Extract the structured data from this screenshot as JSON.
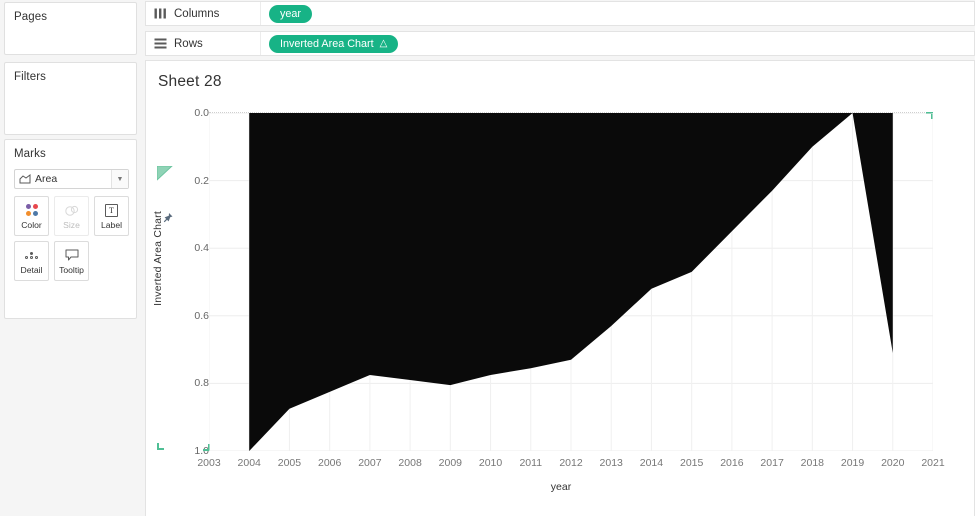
{
  "left_panel": {
    "pages": {
      "title": "Pages"
    },
    "filters": {
      "title": "Filters"
    },
    "marks": {
      "title": "Marks",
      "type_label": "Area",
      "type_icon": "area-chart-icon",
      "caret_icon": "chevron-down-icon",
      "buttons": [
        {
          "label": "Color",
          "icon": "color-dots-icon",
          "disabled": false
        },
        {
          "label": "Size",
          "icon": "size-circles-icon",
          "disabled": true
        },
        {
          "label": "Label",
          "icon": "label-text-icon",
          "disabled": false
        },
        {
          "label": "Detail",
          "icon": "detail-dots-icon",
          "disabled": false
        },
        {
          "label": "Tooltip",
          "icon": "tooltip-bubble-icon",
          "disabled": false
        }
      ],
      "color_dots": [
        "#7b5ea7",
        "#e8484d",
        "#f28e2c",
        "#4e79a7"
      ]
    }
  },
  "shelves": {
    "columns": {
      "label": "Columns",
      "icon": "columns-icon",
      "pill": {
        "text": "year",
        "has_delta": false,
        "delta": ""
      }
    },
    "rows": {
      "label": "Rows",
      "icon": "rows-icon",
      "pill": {
        "text": "Inverted Area Chart",
        "has_delta": true,
        "delta": "△"
      }
    },
    "pill_color": "#17b386"
  },
  "view": {
    "sheet_title": "Sheet 28"
  },
  "chart_data": {
    "type": "area",
    "title": "Sheet 28",
    "xlabel": "year",
    "ylabel": "Inverted Area Chart",
    "grid": true,
    "legend": "none",
    "y_inverted": true,
    "ylim": [
      0.0,
      1.0
    ],
    "y_ticks": [
      "0.0",
      "0.2",
      "0.4",
      "0.6",
      "0.8",
      "1.0"
    ],
    "y_tick_values": [
      0.0,
      0.2,
      0.4,
      0.6,
      0.8,
      1.0
    ],
    "x_ticks": [
      "2003",
      "2004",
      "2005",
      "2006",
      "2007",
      "2008",
      "2009",
      "2010",
      "2011",
      "2012",
      "2013",
      "2014",
      "2015",
      "2016",
      "2017",
      "2018",
      "2019",
      "2020",
      "2021"
    ],
    "xlim": [
      2003,
      2021
    ],
    "fill_color": "#0a0a0a",
    "x": [
      2004,
      2005,
      2006,
      2007,
      2008,
      2009,
      2010,
      2011,
      2012,
      2013,
      2014,
      2015,
      2016,
      2017,
      2018,
      2019,
      2020
    ],
    "values": [
      1.0,
      0.875,
      0.825,
      0.775,
      0.79,
      0.805,
      0.775,
      0.755,
      0.73,
      0.63,
      0.52,
      0.47,
      0.35,
      0.23,
      0.1,
      0.0,
      0.71
    ],
    "baseline": 0.0
  }
}
